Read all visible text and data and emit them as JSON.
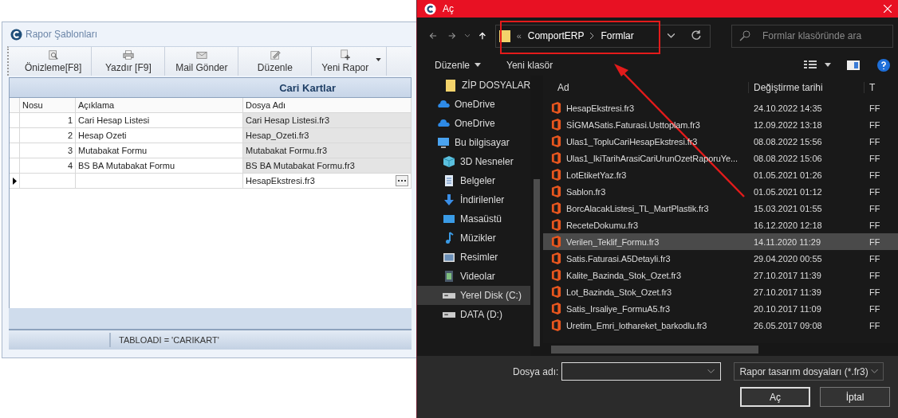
{
  "report_window": {
    "title": "Rapor Şablonları",
    "toolbar": [
      {
        "label": "Önizleme[F8]",
        "kind": "preview",
        "has_menu": false
      },
      {
        "label": "Yazdır [F9]",
        "kind": "print",
        "has_menu": false
      },
      {
        "label": "Mail Gönder",
        "kind": "mail",
        "has_menu": false
      },
      {
        "label": "Düzenle",
        "kind": "edit",
        "has_menu": false
      },
      {
        "label": "Yeni Rapor",
        "kind": "new",
        "has_menu": true
      }
    ],
    "group_header": "Cari Kartlar",
    "columns": [
      "Nosu",
      "Açıklama",
      "Dosya Adı"
    ],
    "rows": [
      {
        "no": "1",
        "description": "Cari  Hesap Listesi",
        "file": "Cari Hesap Listesi.fr3",
        "current": false
      },
      {
        "no": "2",
        "description": "Hesap Ozeti",
        "file": "Hesap_Ozeti.fr3",
        "current": false
      },
      {
        "no": "3",
        "description": "Mutabakat Formu",
        "file": "Mutabakat Formu.fr3",
        "current": false
      },
      {
        "no": "4",
        "description": "BS BA Mutabakat Formu",
        "file": "BS BA Mutabakat Formu.fr3",
        "current": false
      },
      {
        "no": "",
        "description": "",
        "file": "HesapEkstresi.fr3",
        "current": true
      }
    ],
    "status_bar": "TABLOADI = 'CARIKART'"
  },
  "open_dialog": {
    "title": "Aç",
    "overflow_marker": "«",
    "breadcrumb": [
      "ComportERP",
      "Formlar"
    ],
    "search": {
      "placeholder": "Formlar klasöründe ara"
    },
    "commands": [
      {
        "label": "Düzenle",
        "has_menu": true
      },
      {
        "label": "Yeni klasör",
        "has_menu": false
      }
    ],
    "sidebar": [
      {
        "label": "ZİP DOSYALAR",
        "kind": "folder",
        "selected": false
      },
      {
        "label": "OneDrive",
        "kind": "cloud",
        "selected": false
      },
      {
        "label": "OneDrive",
        "kind": "cloud",
        "selected": false
      },
      {
        "label": "Bu bilgisayar",
        "kind": "computer",
        "selected": false,
        "children": [
          {
            "label": "3D Nesneler",
            "kind": "cube",
            "selected": false
          },
          {
            "label": "Belgeler",
            "kind": "document",
            "selected": false
          },
          {
            "label": "İndirilenler",
            "kind": "download",
            "selected": false
          },
          {
            "label": "Masaüstü",
            "kind": "desktop",
            "selected": false
          },
          {
            "label": "Müzikler",
            "kind": "music",
            "selected": false
          },
          {
            "label": "Resimler",
            "kind": "picture",
            "selected": false
          },
          {
            "label": "Videolar",
            "kind": "video",
            "selected": false
          },
          {
            "label": "Yerel Disk (C:)",
            "kind": "drive",
            "selected": true
          },
          {
            "label": "DATA (D:)",
            "kind": "drive",
            "selected": false
          }
        ]
      }
    ],
    "columns": [
      "Ad",
      "Değiştirme tarihi",
      "T"
    ],
    "files": [
      {
        "name": "HesapEkstresi.fr3",
        "date": "24.10.2022 14:35",
        "type": "FF",
        "selected": false
      },
      {
        "name": "SİGMASatis.Faturasi.Usttoplam.fr3",
        "date": "12.09.2022 13:18",
        "type": "FF",
        "selected": false
      },
      {
        "name": "Ulas1_TopluCariHesapEkstresi.fr3",
        "date": "08.08.2022 15:56",
        "type": "FF",
        "selected": false
      },
      {
        "name": "Ulas1_IkiTarihArasiCariUrunOzetRaporuYe...",
        "date": "08.08.2022 15:06",
        "type": "FF",
        "selected": false
      },
      {
        "name": "LotEtiketYaz.fr3",
        "date": "01.05.2021 01:26",
        "type": "FF",
        "selected": false
      },
      {
        "name": "Sablon.fr3",
        "date": "01.05.2021 01:12",
        "type": "FF",
        "selected": false
      },
      {
        "name": "BorcAlacakListesi_TL_MartPlastik.fr3",
        "date": "15.03.2021 01:55",
        "type": "FF",
        "selected": false
      },
      {
        "name": "ReceteDokumu.fr3",
        "date": "16.12.2020 12:18",
        "type": "FF",
        "selected": false
      },
      {
        "name": "Verilen_Teklif_Formu.fr3",
        "date": "14.11.2020 11:29",
        "type": "FF",
        "selected": true
      },
      {
        "name": "Satis.Faturasi.A5Detayli.fr3",
        "date": "29.04.2020 00:55",
        "type": "FF",
        "selected": false
      },
      {
        "name": "Kalite_Bazinda_Stok_Ozet.fr3",
        "date": "27.10.2017 11:39",
        "type": "FF",
        "selected": false
      },
      {
        "name": "Lot_Bazinda_Stok_Ozet.fr3",
        "date": "27.10.2017 11:39",
        "type": "FF",
        "selected": false
      },
      {
        "name": "Satis_Irsaliye_FormuA5.fr3",
        "date": "20.10.2017 11:09",
        "type": "FF",
        "selected": false
      },
      {
        "name": "Uretim_Emri_lothareket_barkodlu.fr3",
        "date": "26.05.2017 09:08",
        "type": "FF",
        "selected": false
      }
    ],
    "filename_label": "Dosya adı:",
    "filter": "Rapor tasarım dosyaları (*.fr3)",
    "buttons": [
      "Aç",
      "İptal"
    ]
  }
}
